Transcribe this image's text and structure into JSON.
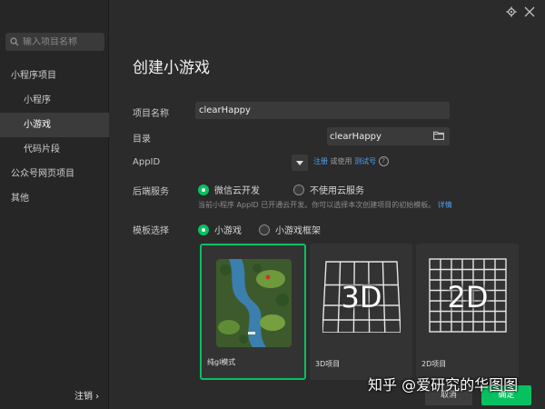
{
  "sidebar": {
    "search_placeholder": "输入项目名称",
    "items": [
      {
        "label": "小程序项目"
      },
      {
        "label": "小程序"
      },
      {
        "label": "小游戏"
      },
      {
        "label": "代码片段"
      },
      {
        "label": "公众号网页项目"
      },
      {
        "label": "其他"
      }
    ],
    "logout_label": "注销 ›"
  },
  "form": {
    "title": "创建小游戏",
    "name_label": "项目名称",
    "name_value": "clearHappy",
    "dir_label": "目录",
    "dir_value": "clearHappy",
    "appid_label": "AppID",
    "register_link": "注册",
    "or_use_text": "或使用",
    "test_link": "测试号",
    "backend_label": "后端服务",
    "cloud_option": "微信云开发",
    "no_cloud_option": "不使用云服务",
    "hint_text": "当前小程序 AppID 已开通云开发。你可以选择本次创建项目的初始模板。",
    "hint_link": "详情",
    "template_label": "模板选择",
    "game_option": "小游戏",
    "framework_option": "小游戏框架"
  },
  "cards": [
    {
      "label": "纯gl模式"
    },
    {
      "label": "3D项目",
      "glyph": "3D"
    },
    {
      "label": "2D项目",
      "glyph": "2D"
    }
  ],
  "footer": {
    "cancel_label": "取消",
    "confirm_label": "确定"
  },
  "watermark": "知乎 @爱研究的华图图",
  "colors": {
    "accent": "#07c160",
    "link": "#4fa0f0"
  }
}
